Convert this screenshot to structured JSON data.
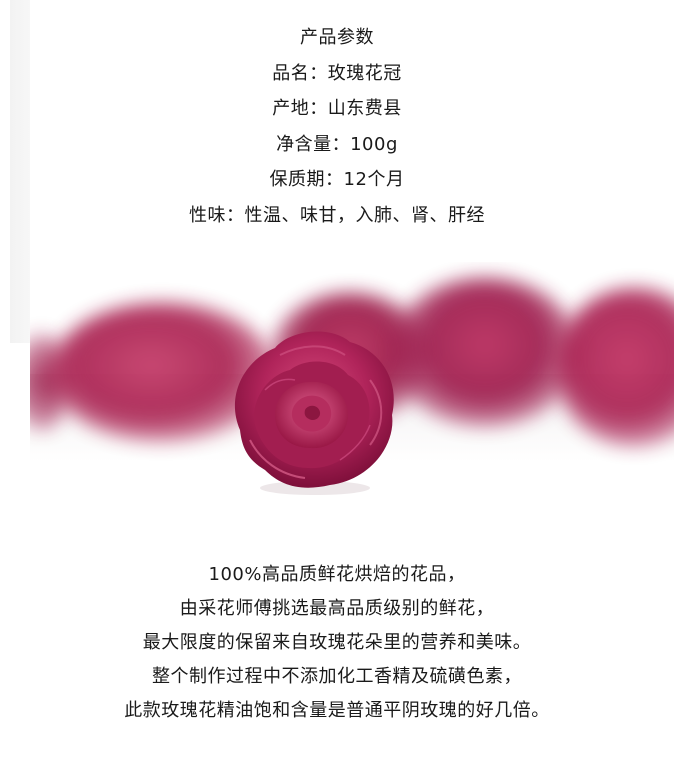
{
  "params": {
    "heading": "产品参数",
    "name": "品名：玫瑰花冠",
    "origin": "产地：山东费县",
    "net_weight": "净含量：100g",
    "shelf_life": "保质期：12个月",
    "nature": "性味：性温、味甘，入肺、肾、肝经"
  },
  "description": {
    "line1": "100%高品质鲜花烘焙的花品，",
    "line2": "由采花师傅挑选最高品质级别的鲜花，",
    "line3": "最大限度的保留来自玫瑰花朵里的营养和美味。",
    "line4": "整个制作过程中不添加化工香精及硫磺色素，",
    "line5": "此款玫瑰花精油饱和含量是普通平阴玫瑰的好几倍。"
  },
  "colors": {
    "rose_dark": "#7e0f3a",
    "rose_mid": "#a81f50",
    "rose_light": "#d0487a",
    "text": "#1a1a1a"
  }
}
